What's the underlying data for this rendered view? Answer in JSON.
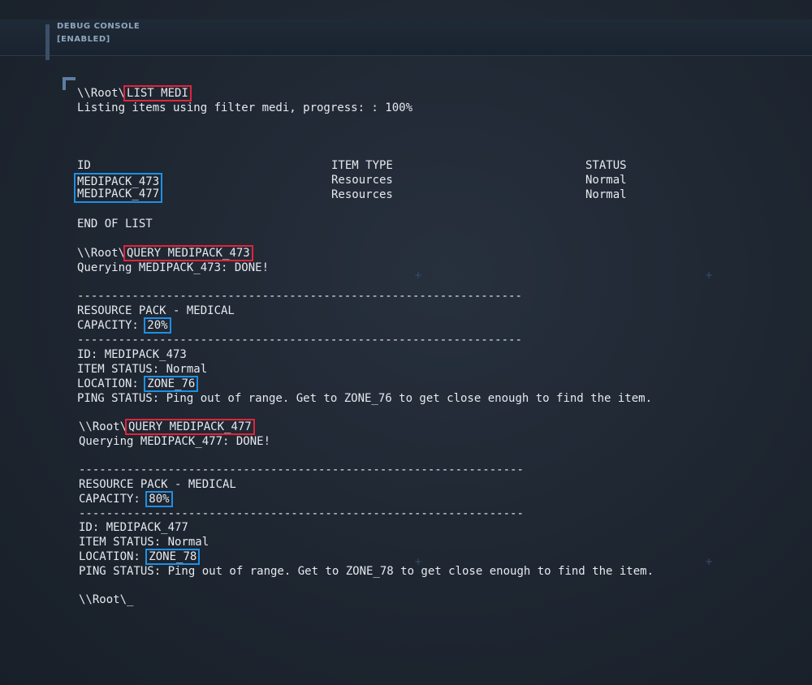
{
  "console": {
    "title": "DEBUG CONSOLE",
    "state": "[ENABLED]"
  },
  "prompt": "\\\\Root\\",
  "cmd1": {
    "command": "LIST MEDI",
    "output": "Listing items using filter medi, progress: : 100%"
  },
  "table": {
    "headers": [
      "ID",
      "ITEM TYPE",
      "STATUS"
    ],
    "rows": [
      {
        "id": "MEDIPACK_473",
        "type": "Resources",
        "status": "Normal"
      },
      {
        "id": "MEDIPACK_477",
        "type": "Resources",
        "status": "Normal"
      }
    ],
    "end": "END OF LIST"
  },
  "divider": "-----------------------------------------------------------------",
  "query1": {
    "command": "QUERY MEDIPACK_473",
    "output": "Querying MEDIPACK_473: DONE!",
    "pack_title": "RESOURCE PACK - MEDICAL",
    "capacity_label": "CAPACITY: ",
    "capacity": "20%",
    "id_line": "ID: MEDIPACK_473",
    "status_line": "ITEM STATUS: Normal",
    "location_label": "LOCATION: ",
    "location": "ZONE_76",
    "ping": "PING STATUS: Ping out of range. Get to ZONE_76 to get close enough to find the item."
  },
  "query2": {
    "command": "QUERY MEDIPACK_477",
    "output": "Querying MEDIPACK_477: DONE!",
    "pack_title": "RESOURCE PACK - MEDICAL",
    "capacity_label": "CAPACITY: ",
    "capacity": "80%",
    "id_line": "ID: MEDIPACK_477",
    "status_line": "ITEM STATUS: Normal",
    "location_label": "LOCATION: ",
    "location": "ZONE_78",
    "ping": "PING STATUS: Ping out of range. Get to ZONE_78 to get close enough to find the item."
  },
  "final_prompt": "\\\\Root\\_",
  "colors": {
    "command_highlight": "#e2233a",
    "value_highlight": "#1e90e6"
  }
}
